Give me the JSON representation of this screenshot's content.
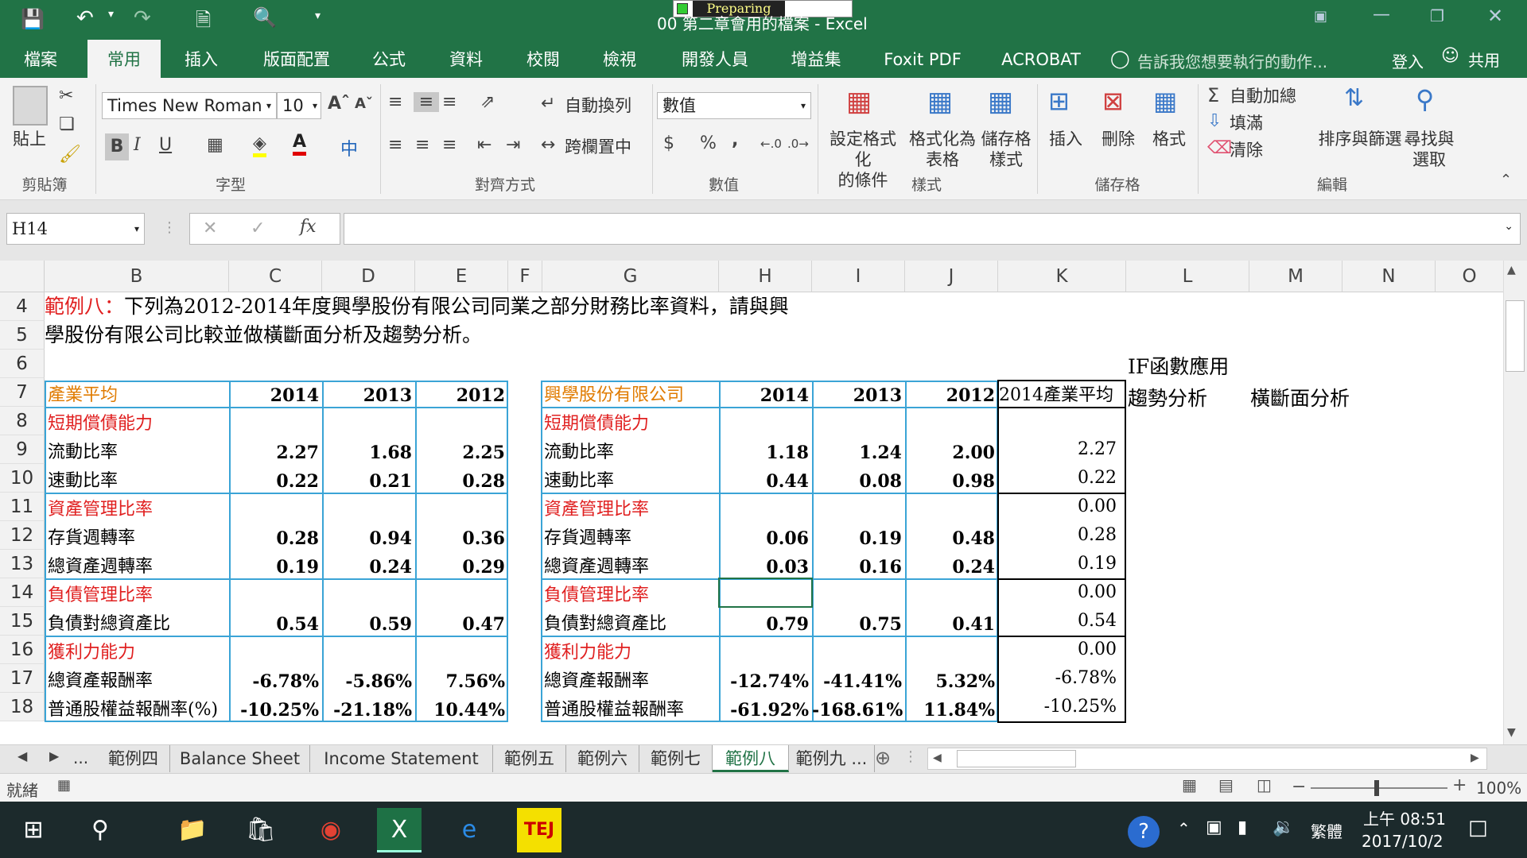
{
  "title": {
    "doc_title": "00 第二章會用的檔案 - Excel",
    "preparing": "Preparing"
  },
  "ribbon_tabs": [
    "檔案",
    "常用",
    "插入",
    "版面配置",
    "公式",
    "資料",
    "校閱",
    "檢視",
    "開發人員",
    "增益集",
    "Foxit PDF",
    "ACROBAT"
  ],
  "tell_me": "告訴我您想要執行的動作...",
  "signin": "登入",
  "share": "共用",
  "font": {
    "name": "Times New Roman",
    "size": "10"
  },
  "number_format": "數值",
  "ribbon": {
    "paste": "貼上",
    "clipboard": "剪貼簿",
    "font_group": "字型",
    "align_group": "對齊方式",
    "number_group": "數值",
    "styles_group": "樣式",
    "cells_group": "儲存格",
    "edit_group": "編輯",
    "wrap": "自動換列",
    "merge": "跨欄置中",
    "cond_fmt": "設定格式化\n的條件",
    "fmt_table": "格式化為\n表格",
    "cell_styles": "儲存格\n樣式",
    "insert": "插入",
    "delete": "刪除",
    "format": "格式",
    "autosum": "自動加總",
    "fill": "填滿",
    "clear": "清除",
    "sort": "排序與篩選",
    "find": "尋找與\n選取",
    "bold": "B",
    "italic": "I",
    "underline": "U",
    "phonetic": "中",
    "currency": "$",
    "percent": "%",
    "comma": ","
  },
  "name_box": "H14",
  "fx": "fx",
  "columns": [
    "B",
    "C",
    "D",
    "E",
    "F",
    "G",
    "H",
    "I",
    "J",
    "K",
    "L",
    "M",
    "N",
    "O"
  ],
  "rows": [
    "4",
    "5",
    "6",
    "7",
    "8",
    "9",
    "10",
    "11",
    "12",
    "13",
    "14",
    "15",
    "16",
    "17",
    "18"
  ],
  "heading": {
    "label": "範例八：",
    "text1": "下列為2012-2014年度興學股份有限公司同業之部分財務比率資料，請與興",
    "text2": "學股份有限公司比較並做橫斷面分析及趨勢分析。"
  },
  "industry": {
    "title": "產業平均",
    "years": [
      "2014",
      "2013",
      "2012"
    ],
    "rows": [
      {
        "label": "短期償債能力",
        "cat": true,
        "v": [
          "",
          "",
          ""
        ]
      },
      {
        "label": "流動比率",
        "v": [
          "2.27",
          "1.68",
          "2.25"
        ]
      },
      {
        "label": "速動比率",
        "v": [
          "0.22",
          "0.21",
          "0.28"
        ]
      },
      {
        "label": "資產管理比率",
        "cat": true,
        "v": [
          "",
          "",
          ""
        ]
      },
      {
        "label": "存貨週轉率",
        "v": [
          "0.28",
          "0.94",
          "0.36"
        ]
      },
      {
        "label": "總資產週轉率",
        "v": [
          "0.19",
          "0.24",
          "0.29"
        ]
      },
      {
        "label": "負債管理比率",
        "cat": true,
        "v": [
          "",
          "",
          ""
        ]
      },
      {
        "label": "負債對總資產比",
        "v": [
          "0.54",
          "0.59",
          "0.47"
        ]
      },
      {
        "label": "獲利力能力",
        "cat": true,
        "v": [
          "",
          "",
          ""
        ]
      },
      {
        "label": "總資產報酬率",
        "v": [
          "-6.78%",
          "-5.86%",
          "7.56%"
        ]
      },
      {
        "label": "普通股權益報酬率(%)",
        "v": [
          "-10.25%",
          "-21.18%",
          "10.44%"
        ]
      }
    ]
  },
  "company": {
    "title": "興學股份有限公司",
    "years": [
      "2014",
      "2013",
      "2012"
    ],
    "k_header": "2014產業平均",
    "rows": [
      {
        "label": "短期償債能力",
        "cat": true,
        "v": [
          "",
          "",
          ""
        ],
        "k": ""
      },
      {
        "label": "流動比率",
        "v": [
          "1.18",
          "1.24",
          "2.00"
        ],
        "k": "2.27"
      },
      {
        "label": "速動比率",
        "v": [
          "0.44",
          "0.08",
          "0.98"
        ],
        "k": "0.22"
      },
      {
        "label": "資產管理比率",
        "cat": true,
        "v": [
          "",
          "",
          ""
        ],
        "k": "0.00"
      },
      {
        "label": "存貨週轉率",
        "v": [
          "0.06",
          "0.19",
          "0.48"
        ],
        "k": "0.28"
      },
      {
        "label": "總資產週轉率",
        "v": [
          "0.03",
          "0.16",
          "0.24"
        ],
        "k": "0.19"
      },
      {
        "label": "負債管理比率",
        "cat": true,
        "v": [
          "",
          "",
          ""
        ],
        "k": "0.00"
      },
      {
        "label": "負債對總資產比",
        "v": [
          "0.79",
          "0.75",
          "0.41"
        ],
        "k": "0.54"
      },
      {
        "label": "獲利力能力",
        "cat": true,
        "v": [
          "",
          "",
          ""
        ],
        "k": "0.00"
      },
      {
        "label": "總資產報酬率",
        "v": [
          "-12.74%",
          "-41.41%",
          "5.32%"
        ],
        "k": "-6.78%"
      },
      {
        "label": "普通股權益報酬率",
        "v": [
          "-61.92%",
          "-168.61%",
          "11.84%"
        ],
        "k": "-10.25%"
      }
    ]
  },
  "notes": {
    "if_func": "IF函數應用",
    "trend": "趨勢分析",
    "cross": "橫斷面分析"
  },
  "sheets": [
    "範例四",
    "Balance Sheet",
    "Income Statement",
    "範例五",
    "範例六",
    "範例七",
    "範例八",
    "範例九 ..."
  ],
  "ellipsis": "...",
  "status": {
    "ready": "就緒",
    "zoom": "100%"
  },
  "taskbar": {
    "time": "上午 08:51",
    "date": "2017/10/2",
    "lang": "繁體"
  }
}
